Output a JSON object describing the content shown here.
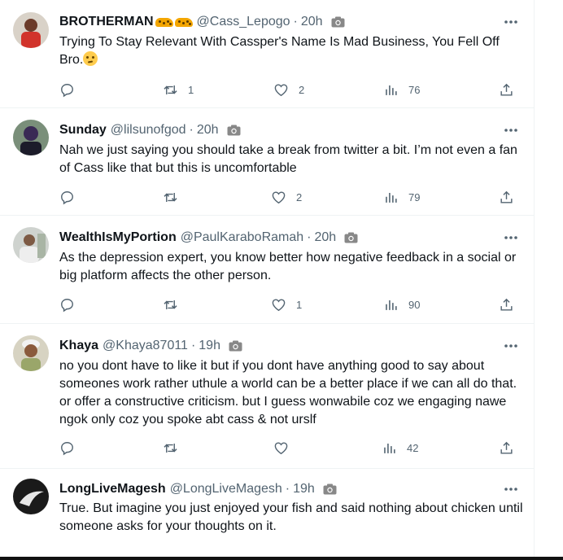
{
  "tweets": [
    {
      "name": "BROTHERMAN",
      "handle": "@Cass_Lepogo",
      "dot": "·",
      "time": "20h",
      "text": "Trying To Stay Relevant With Cassper's Name Is Mad Business, You Fell Off Bro.",
      "emoji": "face-with-rolling-eyes",
      "reply_count": "",
      "retweet_count": "1",
      "like_count": "2",
      "view_count": "76"
    },
    {
      "name": "Sunday",
      "handle": "@lilsunofgod",
      "dot": "·",
      "time": "20h",
      "text": "Nah we just saying you should take a break from twitter a bit. I’m not even a fan of Cass like that but this is uncomfortable",
      "reply_count": "",
      "retweet_count": "",
      "like_count": "2",
      "view_count": "79"
    },
    {
      "name": "WealthIsMyPortion",
      "handle": "@PaulKaraboRamah",
      "dot": "·",
      "time": "20h",
      "text": "As the depression expert, you know better how negative feedback in a social or big platform affects the other person.",
      "reply_count": "",
      "retweet_count": "",
      "like_count": "1",
      "view_count": "90"
    },
    {
      "name": "Khaya",
      "handle": "@Khaya87011",
      "dot": "·",
      "time": "19h",
      "text": "no you dont have to like it but if you dont have anything good to say about someones work rather uthule a world can be a better place if we can all do that. or offer a constructive criticism. but I guess wonwabile coz we engaging nawe ngok only coz you spoke abt cass & not urslf",
      "reply_count": "",
      "retweet_count": "",
      "like_count": "",
      "view_count": "42"
    },
    {
      "name": "LongLiveMagesh",
      "handle": "@LongLiveMagesh",
      "dot": "·",
      "time": "19h",
      "text": "True. But imagine you just enjoyed your fish and said nothing about chicken until someone asks for your thoughts on it.",
      "reply_count": "",
      "retweet_count": "",
      "like_count": "",
      "view_count": ""
    }
  ],
  "icons": {
    "reply": "reply-icon",
    "retweet": "retweet-icon",
    "like": "like-icon",
    "views": "views-icon",
    "share": "share-icon",
    "more": "more-options-icon",
    "camera": "camera-icon"
  },
  "colors": {
    "text": "#0f1419",
    "secondary": "#536471",
    "divider": "#eff3f4"
  }
}
